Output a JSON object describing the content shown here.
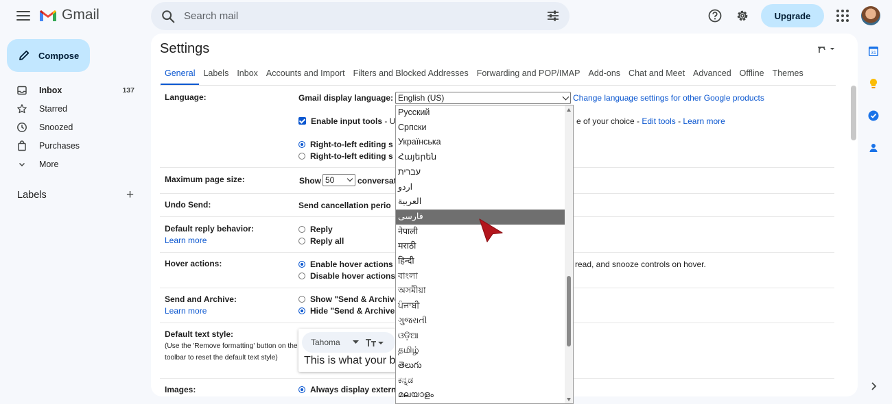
{
  "app": {
    "name": "Gmail"
  },
  "search": {
    "placeholder": "Search mail"
  },
  "header": {
    "upgrade_label": "Upgrade"
  },
  "sidebar": {
    "compose_label": "Compose",
    "items": [
      {
        "label": "Inbox",
        "count": "137",
        "icon": "inbox-icon"
      },
      {
        "label": "Starred",
        "icon": "star-icon"
      },
      {
        "label": "Snoozed",
        "icon": "clock-icon"
      },
      {
        "label": "Purchases",
        "icon": "tag-icon"
      },
      {
        "label": "More",
        "icon": "chevron-down-icon"
      }
    ],
    "labels_heading": "Labels"
  },
  "settings": {
    "title": "Settings",
    "tabs": [
      "General",
      "Labels",
      "Inbox",
      "Accounts and Import",
      "Filters and Blocked Addresses",
      "Forwarding and POP/IMAP",
      "Add-ons",
      "Chat and Meet",
      "Advanced",
      "Offline",
      "Themes"
    ],
    "active_tab": "General",
    "language": {
      "label": "Language:",
      "display_label": "Gmail display language:",
      "selected": "English (US)",
      "change_link": "Change language settings for other Google products",
      "input_tools_prefix": "Enable input tools",
      "input_tools_rest": " - U",
      "input_tools_tail": "e of your choice - ",
      "edit_tools_link": "Edit tools",
      "dash": " - ",
      "learn_more_link": "Learn more",
      "rtl_on": "Right-to-left editing s",
      "rtl_off": "Right-to-left editing s"
    },
    "page_size": {
      "label": "Maximum page size:",
      "show": "Show",
      "value": "50",
      "rest": "conversat"
    },
    "undo_send": {
      "label": "Undo Send:",
      "text": "Send cancellation perio"
    },
    "reply": {
      "label": "Default reply behavior:",
      "learn_more": "Learn more",
      "opt1": "Reply",
      "opt2": "Reply all"
    },
    "hover": {
      "label": "Hover actions:",
      "opt1": "Enable hover actions",
      "opt1_tail": "read, and snooze controls on hover.",
      "opt2": "Disable hover actions"
    },
    "send_archive": {
      "label": "Send and Archive:",
      "learn_more": "Learn more",
      "opt1": "Show \"Send & Archive",
      "opt2": "Hide \"Send & Archive"
    },
    "text_style": {
      "label": "Default text style:",
      "note": "(Use the 'Remove formatting' button on the toolbar to reset the default text style)",
      "font": "Tahoma",
      "preview": "This is what your bo"
    },
    "images": {
      "label": "Images:",
      "opt1": "Always display extern"
    }
  },
  "language_dropdown": {
    "options": [
      "Русский",
      "Српски",
      "Українська",
      "Հայերեն",
      "עברית",
      "اردو",
      "العربية",
      "فارسی",
      "नेपाली",
      "मराठी",
      "हिन्दी",
      "বাংলা",
      "অসমীয়া",
      "ਪੰਜਾਬੀ",
      "ગુજરાતી",
      "ଓଡ଼ିଆ",
      "தமிழ்",
      "తెలుగు",
      "ಕನ್ನಡ",
      "മലയാളം"
    ],
    "highlighted": "فارسی"
  },
  "colors": {
    "accent": "#0b57d0",
    "compose_bg": "#c2e7ff",
    "highlight": "#6f6f6f",
    "cursor": "#b3161d"
  }
}
